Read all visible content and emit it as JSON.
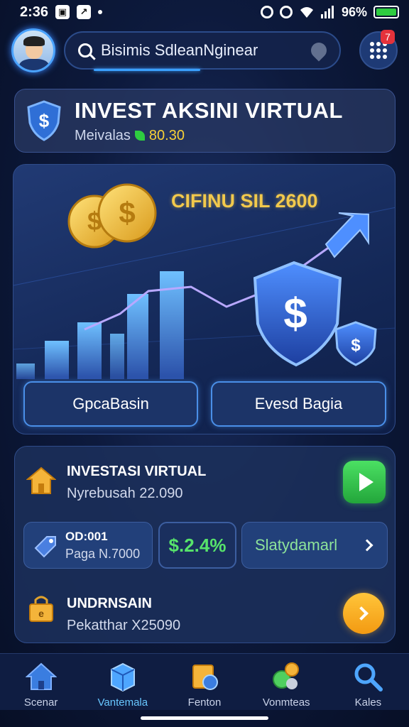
{
  "status_bar": {
    "time": "2:36",
    "battery": "96%"
  },
  "header": {
    "search_text": "Bisimis SdleanNginear",
    "notification_count": "7"
  },
  "balance": {
    "title": "INVEST AKSINI VIRTUAL",
    "label": "Meivalas",
    "value": "80.30"
  },
  "hero": {
    "title": "CIFINU SIL 2600",
    "button_left": "GpcaBasin",
    "button_right": "Evesd Bagia"
  },
  "list": {
    "row1_title": "INVESTASI VIRTUAL",
    "row1_sub": "Nyrebusah 22.090",
    "chip1_title": "OD:001",
    "chip1_sub": "Paga N.7000",
    "chip2_value": "$.2.4%",
    "chip3_label": "Slatydamarl",
    "row3_title": "UNDRNSAIN",
    "row3_sub": "Pekatthar X25090"
  },
  "nav": {
    "items": [
      {
        "label": "Scenar"
      },
      {
        "label": "Vantemala"
      },
      {
        "label": "Fenton"
      },
      {
        "label": "Vonmteas"
      },
      {
        "label": "Kales"
      }
    ]
  },
  "colors": {
    "accent_blue": "#3aa0ff",
    "gold": "#f2c94c",
    "green": "#4be063",
    "orange": "#f39a12",
    "badge_red": "#e5323b"
  }
}
